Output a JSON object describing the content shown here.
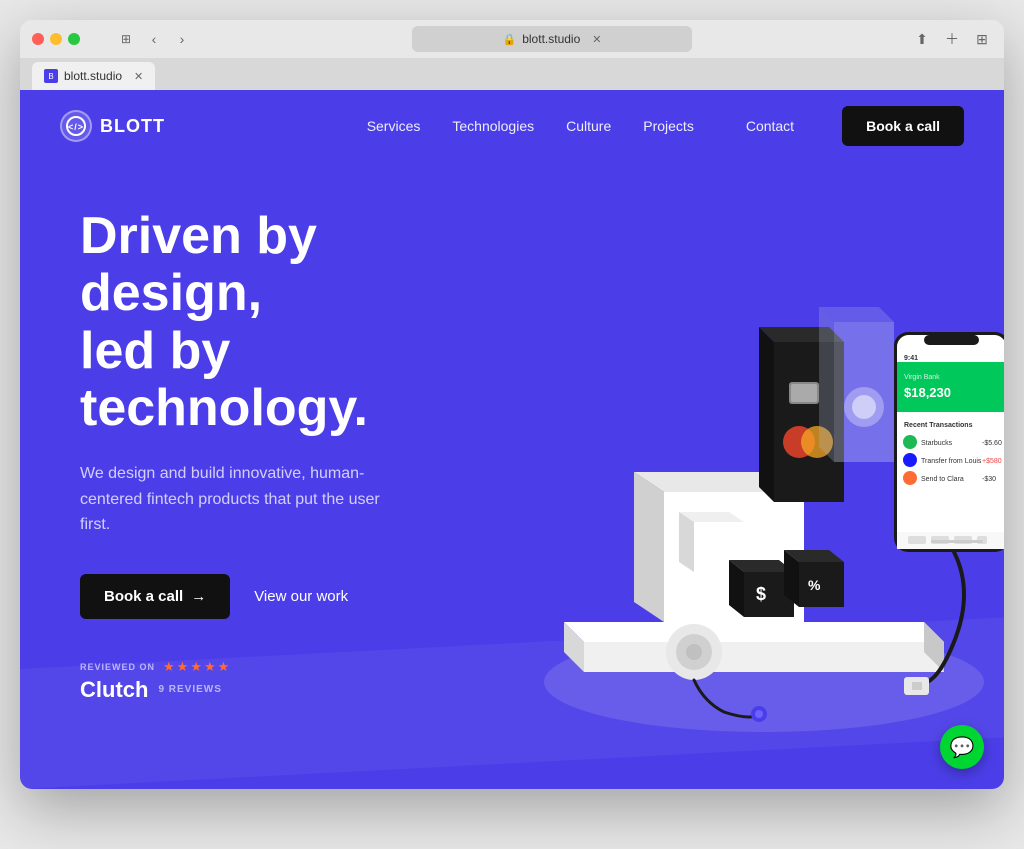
{
  "browser": {
    "url": "blott.studio",
    "tab_title": "blott.studio",
    "tab_favicon": "B"
  },
  "navbar": {
    "logo_text": "BLOTT",
    "logo_symbol": "</> ",
    "links": [
      {
        "label": "Services"
      },
      {
        "label": "Technologies"
      },
      {
        "label": "Culture"
      },
      {
        "label": "Projects"
      },
      {
        "label": "Contact"
      },
      {
        "label": "Book a call"
      }
    ]
  },
  "hero": {
    "title_line1": "Driven by design,",
    "title_line2": "led by technology.",
    "subtitle": "We design and build innovative, human-centered fintech products that put the user first.",
    "cta_primary": "Book a call",
    "cta_arrow": "→",
    "cta_secondary": "View our work",
    "clutch_reviewed": "REVIEWED ON",
    "clutch_name": "Clutch",
    "clutch_reviews_count": "9 REVIEWS"
  },
  "chat": {
    "icon": "💬"
  },
  "colors": {
    "bg": "#4B3EE8",
    "btn_dark": "#111111",
    "star_color": "#FF6B35",
    "chat_green": "#00D632"
  }
}
